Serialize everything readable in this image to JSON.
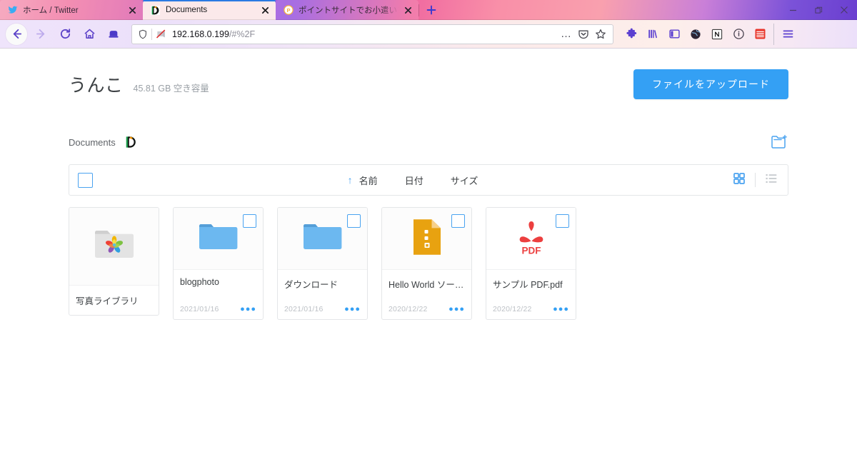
{
  "browser": {
    "tabs": [
      {
        "title": "ホーム / Twitter",
        "favicon": "twitter-bird-icon",
        "active": false
      },
      {
        "title": "Documents",
        "favicon": "documents-d-icon",
        "active": true
      },
      {
        "title": "ポイントサイトでお小遣いを稼ぐなら",
        "favicon": "point-site-icon",
        "active": false
      }
    ],
    "new_tab_label": "+",
    "window_controls": {
      "minimize": "—",
      "maximize": "▢",
      "close": "✕"
    },
    "nav": {
      "back": "back-arrow-icon",
      "forward": "forward-arrow-icon",
      "reload": "reload-icon",
      "home": "home-icon",
      "container": "container-tab-icon"
    },
    "url": {
      "value": "192.168.0.199",
      "path": "/#%2F",
      "shield": "tracking-shield-icon",
      "no_connection": "insecure-icon"
    },
    "url_actions": {
      "more": "…",
      "pocket": "pocket-icon",
      "bookmark": "star-icon"
    },
    "toolbar_icons": [
      "puzzle-extension-icon",
      "library-icon",
      "sidebar-icon",
      "globe-dark-icon",
      "notion-n-icon",
      "info-circle-icon",
      "red-stack-icon",
      "hamburger-menu-icon"
    ]
  },
  "app": {
    "title": "うんこ",
    "quota": "45.81 GB 空き容量",
    "upload_button": "ファイルをアップロード",
    "breadcrumb": {
      "label": "Documents",
      "favicon": "documents-d-icon"
    },
    "new_folder_icon": "new-folder-icon",
    "toolbar": {
      "select_all": "select-all-checkbox",
      "sort_arrow": "↑",
      "columns": [
        "名前",
        "日付",
        "サイズ"
      ],
      "view_grid": "grid-view-icon",
      "view_list": "list-view-icon",
      "active_view": "grid"
    },
    "files": [
      {
        "name": "写真ライブラリ",
        "date": "",
        "icon": "photos-library-folder-icon",
        "type": "photos-library",
        "checkbox": false,
        "menu": false
      },
      {
        "name": "blogphoto",
        "date": "2021/01/16",
        "icon": "blue-folder-icon",
        "type": "folder",
        "checkbox": true,
        "menu": true
      },
      {
        "name": "ダウンロード",
        "date": "2021/01/16",
        "icon": "blue-folder-icon",
        "type": "folder",
        "checkbox": true,
        "menu": true
      },
      {
        "name": "Hello World ソー…",
        "date": "2020/12/22",
        "icon": "code-file-icon",
        "type": "file",
        "checkbox": true,
        "menu": true
      },
      {
        "name": "サンプル PDF.pdf",
        "date": "2020/12/22",
        "icon": "pdf-file-icon",
        "type": "file",
        "checkbox": true,
        "menu": true
      }
    ],
    "menu_dots": "●●●",
    "colors": {
      "accent": "#34a0f4",
      "folder": "#6cb8f0",
      "pdf": "#ec3f3f",
      "code": "#e8a210",
      "border": "#e4e6e8"
    }
  }
}
